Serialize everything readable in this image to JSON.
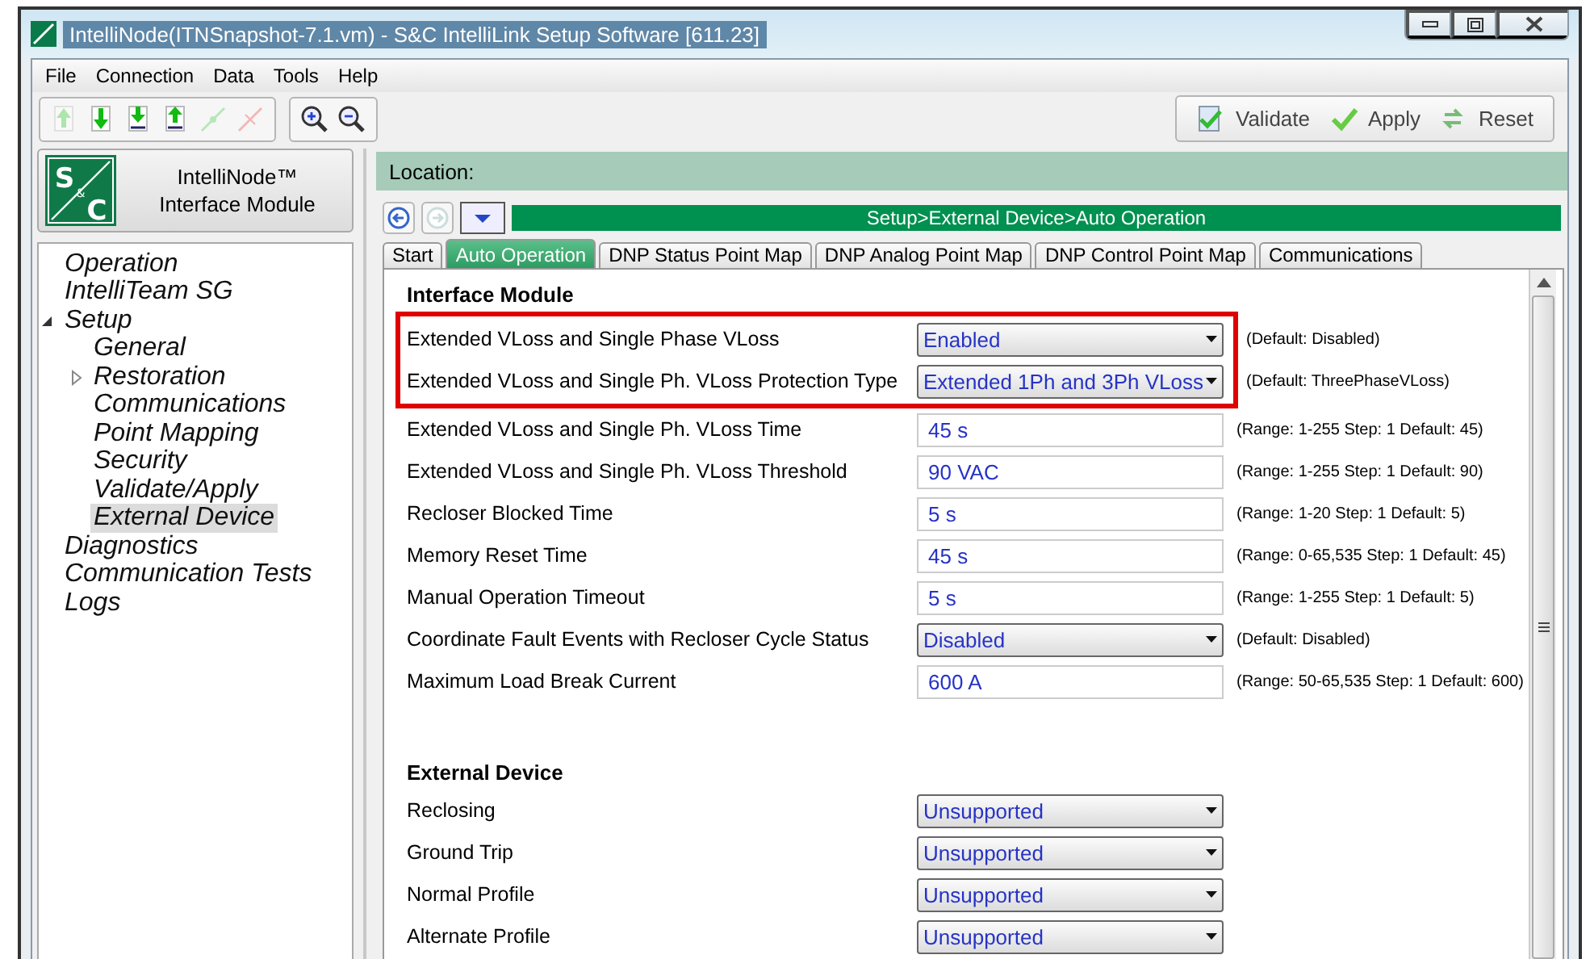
{
  "window": {
    "title": "IntelliNode(ITNSnapshot-7.1.vm) - S&C IntelliLink Setup Software [611.23]"
  },
  "menu": [
    "File",
    "Connection",
    "Data",
    "Tools",
    "Help"
  ],
  "toolbar": {
    "tools": [
      {
        "kind": "upload",
        "disabled": true
      },
      {
        "kind": "download",
        "disabled": false
      },
      {
        "kind": "download-doc",
        "disabled": false
      },
      {
        "kind": "upload-doc",
        "disabled": false
      },
      {
        "kind": "connect",
        "disabled": true
      },
      {
        "kind": "disconnect",
        "disabled": true
      }
    ],
    "zoom": [
      {
        "kind": "zoom-in"
      },
      {
        "kind": "zoom-out"
      }
    ],
    "actions": [
      {
        "kind": "validate",
        "label": "Validate"
      },
      {
        "kind": "apply",
        "label": "Apply"
      },
      {
        "kind": "reset",
        "label": "Reset"
      }
    ]
  },
  "product": {
    "logo": {
      "top": "S",
      "middle": "&",
      "bottom": "C"
    },
    "name": "IntelliNode™",
    "subtitle": "Interface Module"
  },
  "sidebar": {
    "items": [
      {
        "label": "Operation",
        "selected": false
      },
      {
        "label": "IntelliTeam SG",
        "selected": false
      },
      {
        "label": "Setup",
        "selected": false,
        "expanded": true,
        "children": [
          {
            "label": "General",
            "selected": false
          },
          {
            "label": "Restoration",
            "selected": false,
            "expanded": false
          },
          {
            "label": "Communications",
            "selected": false
          },
          {
            "label": "Point Mapping",
            "selected": false
          },
          {
            "label": "Security",
            "selected": false
          },
          {
            "label": "Validate/Apply",
            "selected": false
          },
          {
            "label": "External Device",
            "selected": true
          }
        ]
      },
      {
        "label": "Diagnostics",
        "selected": false
      },
      {
        "label": "Communication Tests",
        "selected": false
      },
      {
        "label": "Logs",
        "selected": false
      }
    ]
  },
  "location": {
    "label": "Location:"
  },
  "breadcrumb": "Setup>External Device>Auto Operation",
  "nav": {
    "back_disabled": false,
    "forward_disabled": true
  },
  "tabs": [
    {
      "label": "Start",
      "selected": false
    },
    {
      "label": "Auto Operation",
      "selected": true
    },
    {
      "label": "DNP Status Point Map",
      "selected": false
    },
    {
      "label": "DNP Analog Point Map",
      "selected": false
    },
    {
      "label": "DNP Control Point Map",
      "selected": false
    },
    {
      "label": "Communications",
      "selected": false
    }
  ],
  "sections": [
    {
      "title": "Interface Module",
      "rows": [
        {
          "label": "Extended VLoss and Single Phase VLoss",
          "kind": "dropdown",
          "value": "Enabled",
          "hint": "(Default: Disabled)",
          "highlighted": true
        },
        {
          "label": "Extended VLoss and Single Ph. VLoss Protection Type",
          "kind": "dropdown",
          "value": "Extended 1Ph and 3Ph VLoss",
          "hint": "(Default: ThreePhaseVLoss)",
          "highlighted": true
        },
        {
          "label": "Extended VLoss and Single Ph. VLoss Time",
          "kind": "field",
          "value": "45 s",
          "hint": "(Range: 1-255 Step: 1 Default: 45)",
          "highlighted": false
        },
        {
          "label": "Extended VLoss and Single Ph. VLoss Threshold",
          "kind": "field",
          "value": "90 VAC",
          "hint": "(Range: 1-255 Step: 1 Default: 90)",
          "highlighted": false
        },
        {
          "label": "Recloser Blocked Time",
          "kind": "field",
          "value": "5 s",
          "hint": "(Range: 1-20 Step: 1 Default: 5)",
          "highlighted": false
        },
        {
          "label": "Memory Reset Time",
          "kind": "field",
          "value": "45 s",
          "hint": "(Range: 0-65,535 Step: 1 Default: 45)",
          "highlighted": false
        },
        {
          "label": "Manual Operation Timeout",
          "kind": "field",
          "value": "5 s",
          "hint": "(Range: 1-255 Step: 1 Default: 5)",
          "highlighted": false
        },
        {
          "label": "Coordinate Fault Events with Recloser Cycle Status",
          "kind": "dropdown",
          "value": "Disabled",
          "hint": "(Default: Disabled)",
          "highlighted": false
        },
        {
          "label": "Maximum Load Break Current",
          "kind": "field",
          "value": "600 A",
          "hint": "(Range: 50-65,535 Step: 1 Default: 600)",
          "highlighted": false
        }
      ]
    },
    {
      "title": "External Device",
      "rows": [
        {
          "label": "Reclosing",
          "kind": "dropdown",
          "value": "Unsupported",
          "highlighted": false
        },
        {
          "label": "Ground Trip",
          "kind": "dropdown",
          "value": "Unsupported",
          "highlighted": false
        },
        {
          "label": "Normal Profile",
          "kind": "dropdown",
          "value": "Unsupported",
          "highlighted": false
        },
        {
          "label": "Alternate Profile",
          "kind": "dropdown",
          "value": "Unsupported",
          "highlighted": false
        }
      ]
    }
  ]
}
